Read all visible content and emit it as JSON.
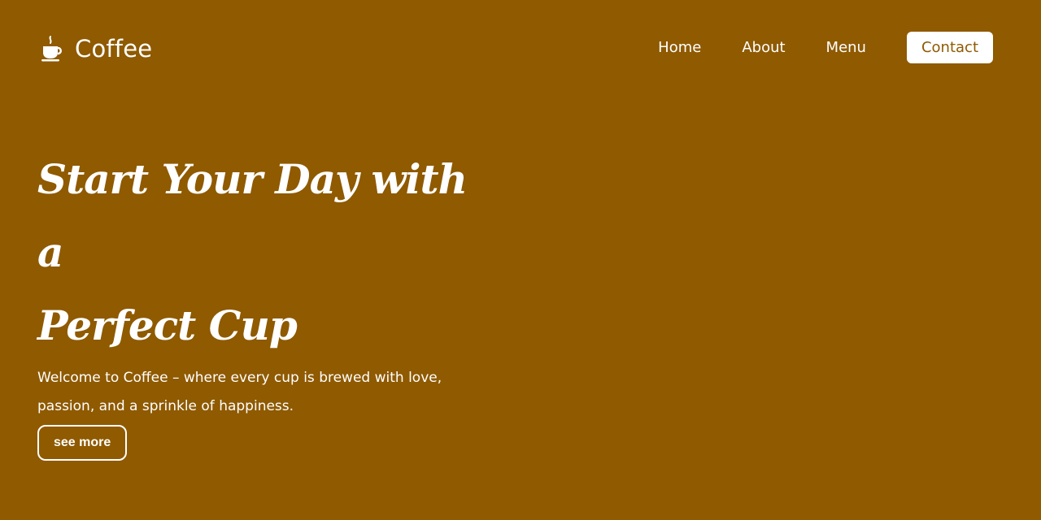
{
  "header": {
    "brand": {
      "icon": "coffee-cup-icon",
      "name": "Coffee"
    },
    "nav": {
      "home": "Home",
      "about": "About",
      "menu": "Menu",
      "contact": "Contact"
    }
  },
  "hero": {
    "title_line1": "Start Your Day with a",
    "title_line2": "Perfect Cup",
    "text_line1": "Welcome to Coffee – where every cup is brewed with love,",
    "text_line2": "passion, and a sprinkle of happiness.",
    "button_label": "see more"
  },
  "colors": {
    "background": "#8f5a00",
    "text": "#ffffff",
    "contact_button_bg": "#ffffff",
    "contact_button_text": "#8f5a00"
  }
}
